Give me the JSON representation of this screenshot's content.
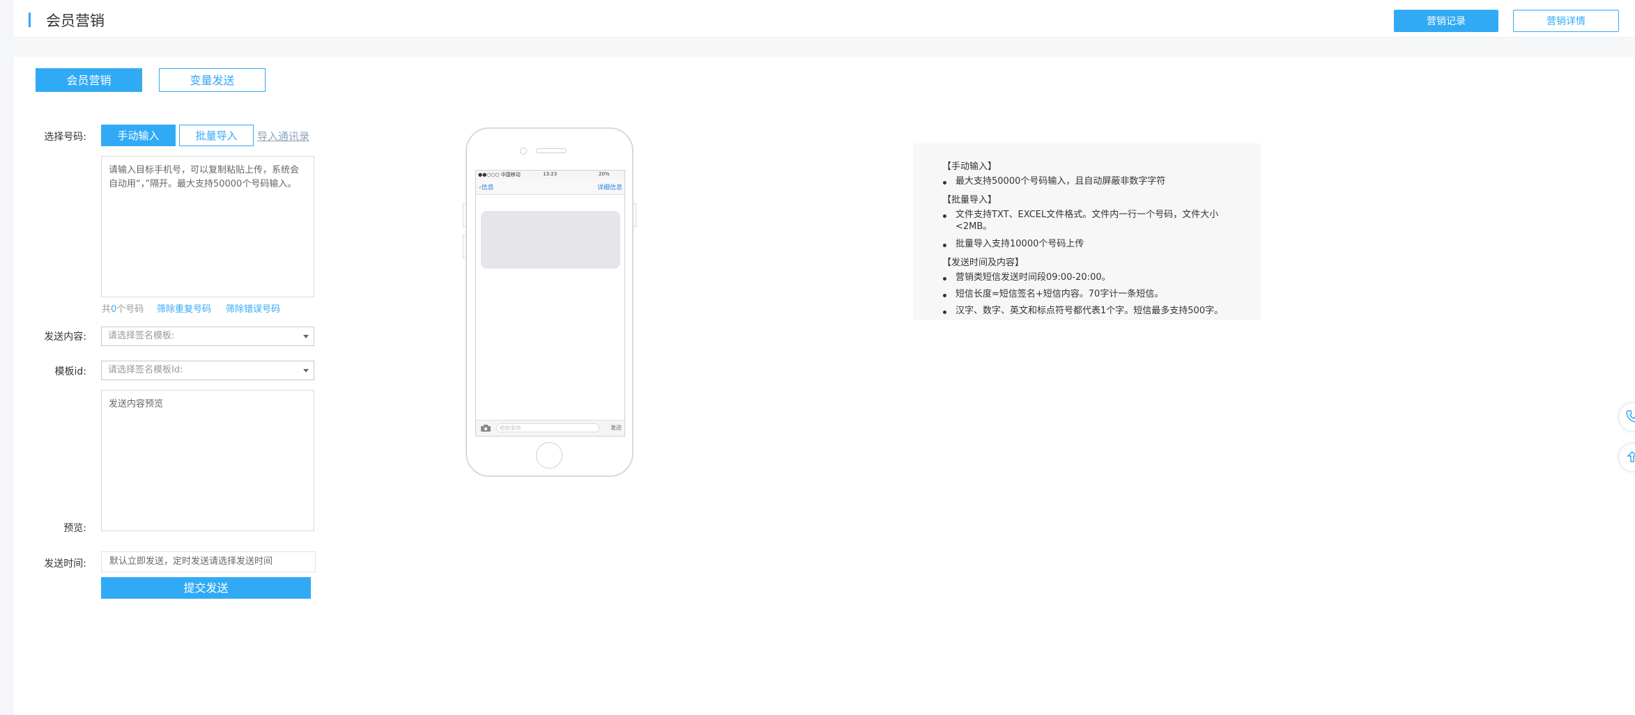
{
  "header": {
    "title": "会员营销",
    "buttons": {
      "records": "营销记录",
      "details": "营销详情"
    }
  },
  "tabs": [
    {
      "label": "会员营销",
      "active": true
    },
    {
      "label": "变量发送",
      "active": false
    }
  ],
  "form": {
    "select_number_label": "选择号码:",
    "manual_input": "手动输入",
    "batch_import": "批量导入",
    "import_contacts": "导入通讯录",
    "numbers_placeholder": "请输入目标手机号，可以复制粘贴上传，系统会自动用“，”隔开。最大支持50000个号码输入。",
    "count_prefix": "共",
    "count_value": "0",
    "count_suffix": "个号码",
    "remove_duplicates": "筛除重复号码",
    "remove_invalid": "筛除错误号码",
    "content_label": "发送内容:",
    "content_placeholder": "请选择签名模板:",
    "template_label": "模板id:",
    "template_placeholder": "请选择签名模板Id:",
    "preview_text": "发送内容预览",
    "preview_label": "预览:",
    "send_time_label": "发送时间:",
    "send_time_placeholder": "默认立即发送，定时发送请选择发送时间",
    "submit": "提交发送"
  },
  "phone": {
    "carrier": "●●○○○ 中国移动",
    "time": "13:23",
    "battery": "20%",
    "back": "信息",
    "detail": "详细信息",
    "input_placeholder": "短信/彩信",
    "send": "发送"
  },
  "info": {
    "sections": [
      {
        "title": "【手动输入】",
        "items": [
          "最大支持50000个号码输入，且自动屏蔽非数字字符"
        ]
      },
      {
        "title": "【批量导入】",
        "items": [
          "文件支持TXT、EXCEL文件格式。文件内一行一个号码，文件大小<2MB。",
          "批量导入支持10000个号码上传"
        ]
      },
      {
        "title": "【发送时间及内容】",
        "items": [
          "营销类短信发送时间段09:00-20:00。",
          "短信长度=短信签名+短信内容。70字计一条短信。",
          "汉字、数字、英文和标点符号都代表1个字。短信最多支持500字。"
        ]
      }
    ]
  },
  "colors": {
    "accent": "#31aaf5",
    "background": "#f4f6fa"
  },
  "icons": [
    "phone-icon",
    "share-icon",
    "camera-icon",
    "back-chevron-icon"
  ]
}
